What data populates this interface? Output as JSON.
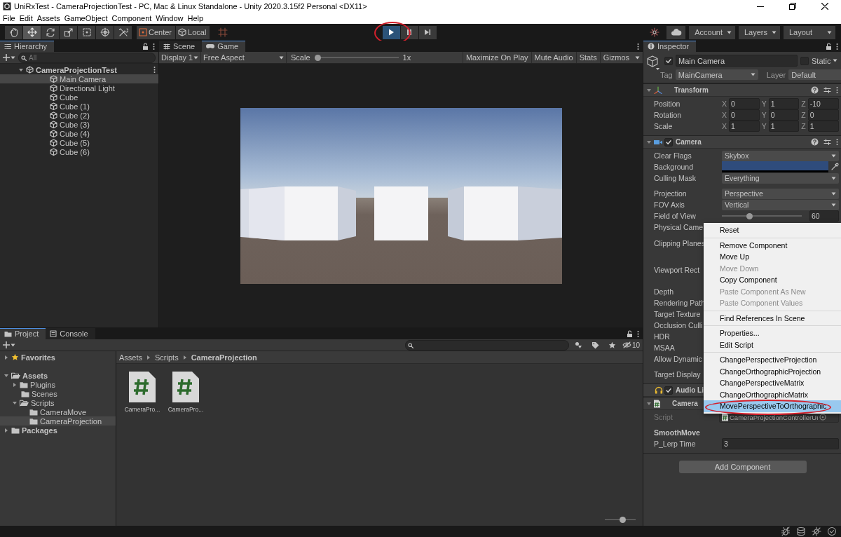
{
  "window": {
    "title": "UniRxTest - CameraProjectionTest - PC, Mac & Linux Standalone - Unity 2020.3.15f2 Personal <DX11>"
  },
  "menu_bar": [
    "File",
    "Edit",
    "Assets",
    "GameObject",
    "Component",
    "Window",
    "Help"
  ],
  "toolbar": {
    "tools": [
      {
        "kind": "hand",
        "selected": false
      },
      {
        "kind": "move",
        "selected": true
      },
      {
        "kind": "rotate",
        "selected": false
      },
      {
        "kind": "scale",
        "selected": false
      },
      {
        "kind": "rect",
        "selected": false
      },
      {
        "kind": "transform",
        "selected": false
      },
      {
        "kind": "custom",
        "selected": false
      }
    ],
    "pivot": [
      {
        "kind": "pivot",
        "label": "Center"
      },
      {
        "kind": "space",
        "label": "Local"
      }
    ],
    "playback": [
      {
        "kind": "play",
        "selected": true,
        "circled": true
      },
      {
        "kind": "pause",
        "selected": false,
        "circled": false
      },
      {
        "kind": "step",
        "selected": false,
        "circled": false
      }
    ],
    "menus": [
      "Account",
      "Layers",
      "Layout"
    ]
  },
  "hierarchy": {
    "title": "Hierarchy",
    "search_placeholder": "All",
    "items": [
      {
        "kind": "scene",
        "name": "CameraProjectionTest",
        "expanded": true,
        "selected": false,
        "children": [
          {
            "kind": "object",
            "name": "Main Camera",
            "selected": true
          },
          {
            "kind": "object",
            "name": "Directional Light",
            "selected": false
          },
          {
            "kind": "object",
            "name": "Cube",
            "selected": false
          },
          {
            "kind": "object",
            "name": "Cube (1)",
            "selected": false
          },
          {
            "kind": "object",
            "name": "Cube (2)",
            "selected": false
          },
          {
            "kind": "object",
            "name": "Cube (3)",
            "selected": false
          },
          {
            "kind": "object",
            "name": "Cube (4)",
            "selected": false
          },
          {
            "kind": "object",
            "name": "Cube (5)",
            "selected": false
          },
          {
            "kind": "object",
            "name": "Cube (6)",
            "selected": false
          }
        ]
      }
    ]
  },
  "game": {
    "tabs": [
      {
        "kind": "scene",
        "label": "Scene",
        "selected": false
      },
      {
        "kind": "game",
        "label": "Game",
        "selected": true
      }
    ],
    "display": "Display 1",
    "aspect": "Free Aspect",
    "scale": {
      "label": "Scale",
      "level": 0,
      "reading": "1x"
    },
    "toggles": [
      "Maximize On Play",
      "Mute Audio",
      "Stats",
      "Gizmos"
    ],
    "view": {
      "kind": "picture"
    }
  },
  "project": {
    "tabs": [
      {
        "kind": "project",
        "label": "Project",
        "selected": true
      },
      {
        "kind": "console",
        "label": "Console",
        "selected": false
      }
    ],
    "hidden_count": "10",
    "tree": [
      {
        "kind": "favorites",
        "name": "Favorites",
        "expanded": false,
        "selected": false
      },
      {
        "kind": "folder",
        "name": "Assets",
        "expanded": true,
        "selected": false,
        "children": [
          {
            "kind": "folder",
            "name": "Plugins",
            "expanded": false,
            "selected": false
          },
          {
            "kind": "folder",
            "name": "Scenes",
            "selected": false
          },
          {
            "kind": "folder",
            "name": "Scripts",
            "expanded": true,
            "selected": false,
            "children": [
              {
                "kind": "folder",
                "name": "CameraMove",
                "selected": false
              },
              {
                "kind": "folder",
                "name": "CameraProjection",
                "selected": true
              }
            ]
          }
        ]
      },
      {
        "kind": "folder",
        "name": "Packages",
        "expanded": false,
        "selected": false
      }
    ],
    "breadcrumb": [
      "Assets",
      "Scripts",
      "CameraProjection"
    ],
    "files": [
      {
        "kind": "script",
        "name": "CameraPro..."
      },
      {
        "kind": "script",
        "name": "CameraPro..."
      }
    ],
    "zoom": {
      "level": 0.6
    }
  },
  "inspector": {
    "title": "Inspector",
    "object": {
      "active": true,
      "name": "Main Camera",
      "static": false,
      "static_label": "Static",
      "tag_label": "Tag",
      "tag": "MainCamera",
      "layer_label": "Layer",
      "layer": "Default"
    },
    "components": [
      {
        "kind": "transform",
        "title": "Transform",
        "expanded": true,
        "header_icons": true,
        "rows": [
          {
            "kind": "vector",
            "label": "Position",
            "values": [
              {
                "axis": "X",
                "value": "0"
              },
              {
                "axis": "Y",
                "value": "1"
              },
              {
                "axis": "Z",
                "value": "-10"
              }
            ]
          },
          {
            "kind": "vector",
            "label": "Rotation",
            "values": [
              {
                "axis": "X",
                "value": "0"
              },
              {
                "axis": "Y",
                "value": "0"
              },
              {
                "axis": "Z",
                "value": "0"
              }
            ]
          },
          {
            "kind": "vector",
            "label": "Scale",
            "values": [
              {
                "axis": "X",
                "value": "1"
              },
              {
                "axis": "Y",
                "value": "1"
              },
              {
                "axis": "Z",
                "value": "1"
              }
            ]
          }
        ]
      },
      {
        "kind": "camera",
        "title": "Camera",
        "expanded": true,
        "enabled": true,
        "header_icons": true,
        "rows": [
          {
            "kind": "dropdown",
            "label": "Clear Flags",
            "value": "Skybox"
          },
          {
            "kind": "color",
            "label": "Background",
            "color": "#2f4c7c"
          },
          {
            "kind": "dropdown",
            "label": "Culling Mask",
            "value": "Everything"
          },
          {
            "kind": "dropdown",
            "label": "Projection",
            "value": "Perspective",
            "separated": true
          },
          {
            "kind": "dropdown",
            "label": "FOV Axis",
            "value": "Vertical"
          },
          {
            "kind": "slider",
            "label": "Field of View",
            "level": 0.33,
            "value": "60"
          },
          {
            "kind": "label",
            "label": "Physical Came"
          },
          {
            "kind": "tall",
            "label": "Clipping Planes"
          },
          {
            "kind": "tall",
            "label": "Viewport Rect"
          },
          {
            "kind": "label",
            "label": "Depth"
          },
          {
            "kind": "label",
            "label": "Rendering Path"
          },
          {
            "kind": "label",
            "label": "Target Texture"
          },
          {
            "kind": "label",
            "label": "Occlusion Culli"
          },
          {
            "kind": "label",
            "label": "HDR"
          },
          {
            "kind": "label",
            "label": "MSAA"
          },
          {
            "kind": "label",
            "label": "Allow Dynamic"
          },
          {
            "kind": "label",
            "label": "Target Display",
            "separated": true
          }
        ]
      },
      {
        "kind": "audio",
        "title": "Audio Li",
        "enabled": true
      },
      {
        "kind": "script",
        "title": "Camera",
        "expanded": true,
        "rows": [
          {
            "kind": "object",
            "label": "Script",
            "value": "CameraProjectionControllerUı",
            "disabled": true
          },
          {
            "kind": "heading",
            "label": "SmoothMove"
          },
          {
            "kind": "text",
            "label": "P_Lerp Time",
            "value": "3"
          }
        ]
      }
    ],
    "add_button": "Add Component",
    "context_menu": {
      "groups": [
        [
          {
            "label": "Reset",
            "disabled": false,
            "selected": false,
            "circled": false
          }
        ],
        [
          {
            "label": "Remove Component",
            "disabled": false,
            "selected": false,
            "circled": false
          },
          {
            "label": "Move Up",
            "disabled": false,
            "selected": false,
            "circled": false
          },
          {
            "label": "Move Down",
            "disabled": true,
            "selected": false,
            "circled": false
          },
          {
            "label": "Copy Component",
            "disabled": false,
            "selected": false,
            "circled": false
          },
          {
            "label": "Paste Component As New",
            "disabled": true,
            "selected": false,
            "circled": false
          },
          {
            "label": "Paste Component Values",
            "disabled": true,
            "selected": false,
            "circled": false
          }
        ],
        [
          {
            "label": "Find References In Scene",
            "disabled": false,
            "selected": false,
            "circled": false
          }
        ],
        [
          {
            "label": "Properties...",
            "disabled": false,
            "selected": false,
            "circled": false
          },
          {
            "label": "Edit Script",
            "disabled": false,
            "selected": false,
            "circled": false
          }
        ],
        [
          {
            "label": "ChangePerspectiveProjection",
            "disabled": false,
            "selected": false,
            "circled": false
          },
          {
            "label": "ChangeOrthographicProjection",
            "disabled": false,
            "selected": false,
            "circled": false
          },
          {
            "label": "ChangePerspectiveMatrix",
            "disabled": false,
            "selected": false,
            "circled": false
          },
          {
            "label": "ChangeOrthographicMatrix",
            "disabled": false,
            "selected": false,
            "circled": false
          },
          {
            "label": "MovePerspectiveToOrthographic",
            "disabled": false,
            "selected": true,
            "circled": true
          }
        ]
      ]
    }
  }
}
